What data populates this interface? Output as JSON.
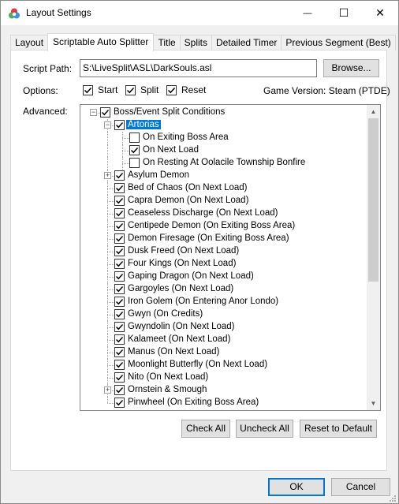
{
  "window": {
    "title": "Layout Settings",
    "minimize_glyph": "—",
    "maximize_glyph": "☐",
    "close_glyph": "✕"
  },
  "tabs": [
    {
      "label": "Layout",
      "active": false
    },
    {
      "label": "Scriptable Auto Splitter",
      "active": true
    },
    {
      "label": "Title",
      "active": false
    },
    {
      "label": "Splits",
      "active": false
    },
    {
      "label": "Detailed Timer",
      "active": false
    },
    {
      "label": "Previous Segment (Best)",
      "active": false
    }
  ],
  "script": {
    "label": "Script Path:",
    "path": "S:\\LiveSplit\\ASL\\DarkSouls.asl",
    "browse_label": "Browse..."
  },
  "options": {
    "label": "Options:",
    "start": {
      "label": "Start",
      "checked": true
    },
    "split": {
      "label": "Split",
      "checked": true
    },
    "reset": {
      "label": "Reset",
      "checked": true
    },
    "game_version": "Game Version: Steam (PTDE)"
  },
  "advanced": {
    "label": "Advanced:",
    "tree": [
      {
        "label": "Boss/Event Split Conditions",
        "level": 0,
        "checked": true,
        "expander": "-",
        "selected": false
      },
      {
        "label": "Artorias",
        "level": 1,
        "checked": true,
        "expander": "-",
        "selected": true
      },
      {
        "label": "On Exiting Boss Area",
        "level": 2,
        "checked": false,
        "expander": "",
        "selected": false
      },
      {
        "label": "On Next Load",
        "level": 2,
        "checked": true,
        "expander": "",
        "selected": false
      },
      {
        "label": "On Resting At Oolacile Township Bonfire",
        "level": 2,
        "checked": false,
        "expander": "",
        "selected": false
      },
      {
        "label": "Asylum Demon",
        "level": 1,
        "checked": true,
        "expander": "+",
        "selected": false
      },
      {
        "label": "Bed of Chaos (On Next Load)",
        "level": 1,
        "checked": true,
        "expander": "",
        "selected": false
      },
      {
        "label": "Capra Demon (On Next Load)",
        "level": 1,
        "checked": true,
        "expander": "",
        "selected": false
      },
      {
        "label": "Ceaseless Discharge (On Next Load)",
        "level": 1,
        "checked": true,
        "expander": "",
        "selected": false
      },
      {
        "label": "Centipede Demon (On Exiting Boss Area)",
        "level": 1,
        "checked": true,
        "expander": "",
        "selected": false
      },
      {
        "label": "Demon Firesage (On Exiting Boss Area)",
        "level": 1,
        "checked": true,
        "expander": "",
        "selected": false
      },
      {
        "label": "Dusk Freed (On Next Load)",
        "level": 1,
        "checked": true,
        "expander": "",
        "selected": false
      },
      {
        "label": "Four Kings (On Next Load)",
        "level": 1,
        "checked": true,
        "expander": "",
        "selected": false
      },
      {
        "label": "Gaping Dragon (On Next Load)",
        "level": 1,
        "checked": true,
        "expander": "",
        "selected": false
      },
      {
        "label": "Gargoyles (On Next Load)",
        "level": 1,
        "checked": true,
        "expander": "",
        "selected": false
      },
      {
        "label": "Iron Golem (On Entering Anor Londo)",
        "level": 1,
        "checked": true,
        "expander": "",
        "selected": false
      },
      {
        "label": "Gwyn (On Credits)",
        "level": 1,
        "checked": true,
        "expander": "",
        "selected": false
      },
      {
        "label": "Gwyndolin (On Next Load)",
        "level": 1,
        "checked": true,
        "expander": "",
        "selected": false
      },
      {
        "label": "Kalameet (On Next Load)",
        "level": 1,
        "checked": true,
        "expander": "",
        "selected": false
      },
      {
        "label": "Manus (On Next Load)",
        "level": 1,
        "checked": true,
        "expander": "",
        "selected": false
      },
      {
        "label": "Moonlight Butterfly (On Next Load)",
        "level": 1,
        "checked": true,
        "expander": "",
        "selected": false
      },
      {
        "label": "Nito (On Next Load)",
        "level": 1,
        "checked": true,
        "expander": "",
        "selected": false
      },
      {
        "label": "Ornstein & Smough",
        "level": 1,
        "checked": true,
        "expander": "+",
        "selected": false
      },
      {
        "label": "Pinwheel (On Exiting Boss Area)",
        "level": 1,
        "checked": true,
        "expander": "",
        "selected": false
      }
    ]
  },
  "buttons": {
    "check_all": "Check All",
    "uncheck_all": "Uncheck All",
    "reset_default": "Reset to Default",
    "ok": "OK",
    "cancel": "Cancel"
  },
  "colors": {
    "selection": "#0078d7",
    "scroll_thumb": "#cdcdcd"
  }
}
